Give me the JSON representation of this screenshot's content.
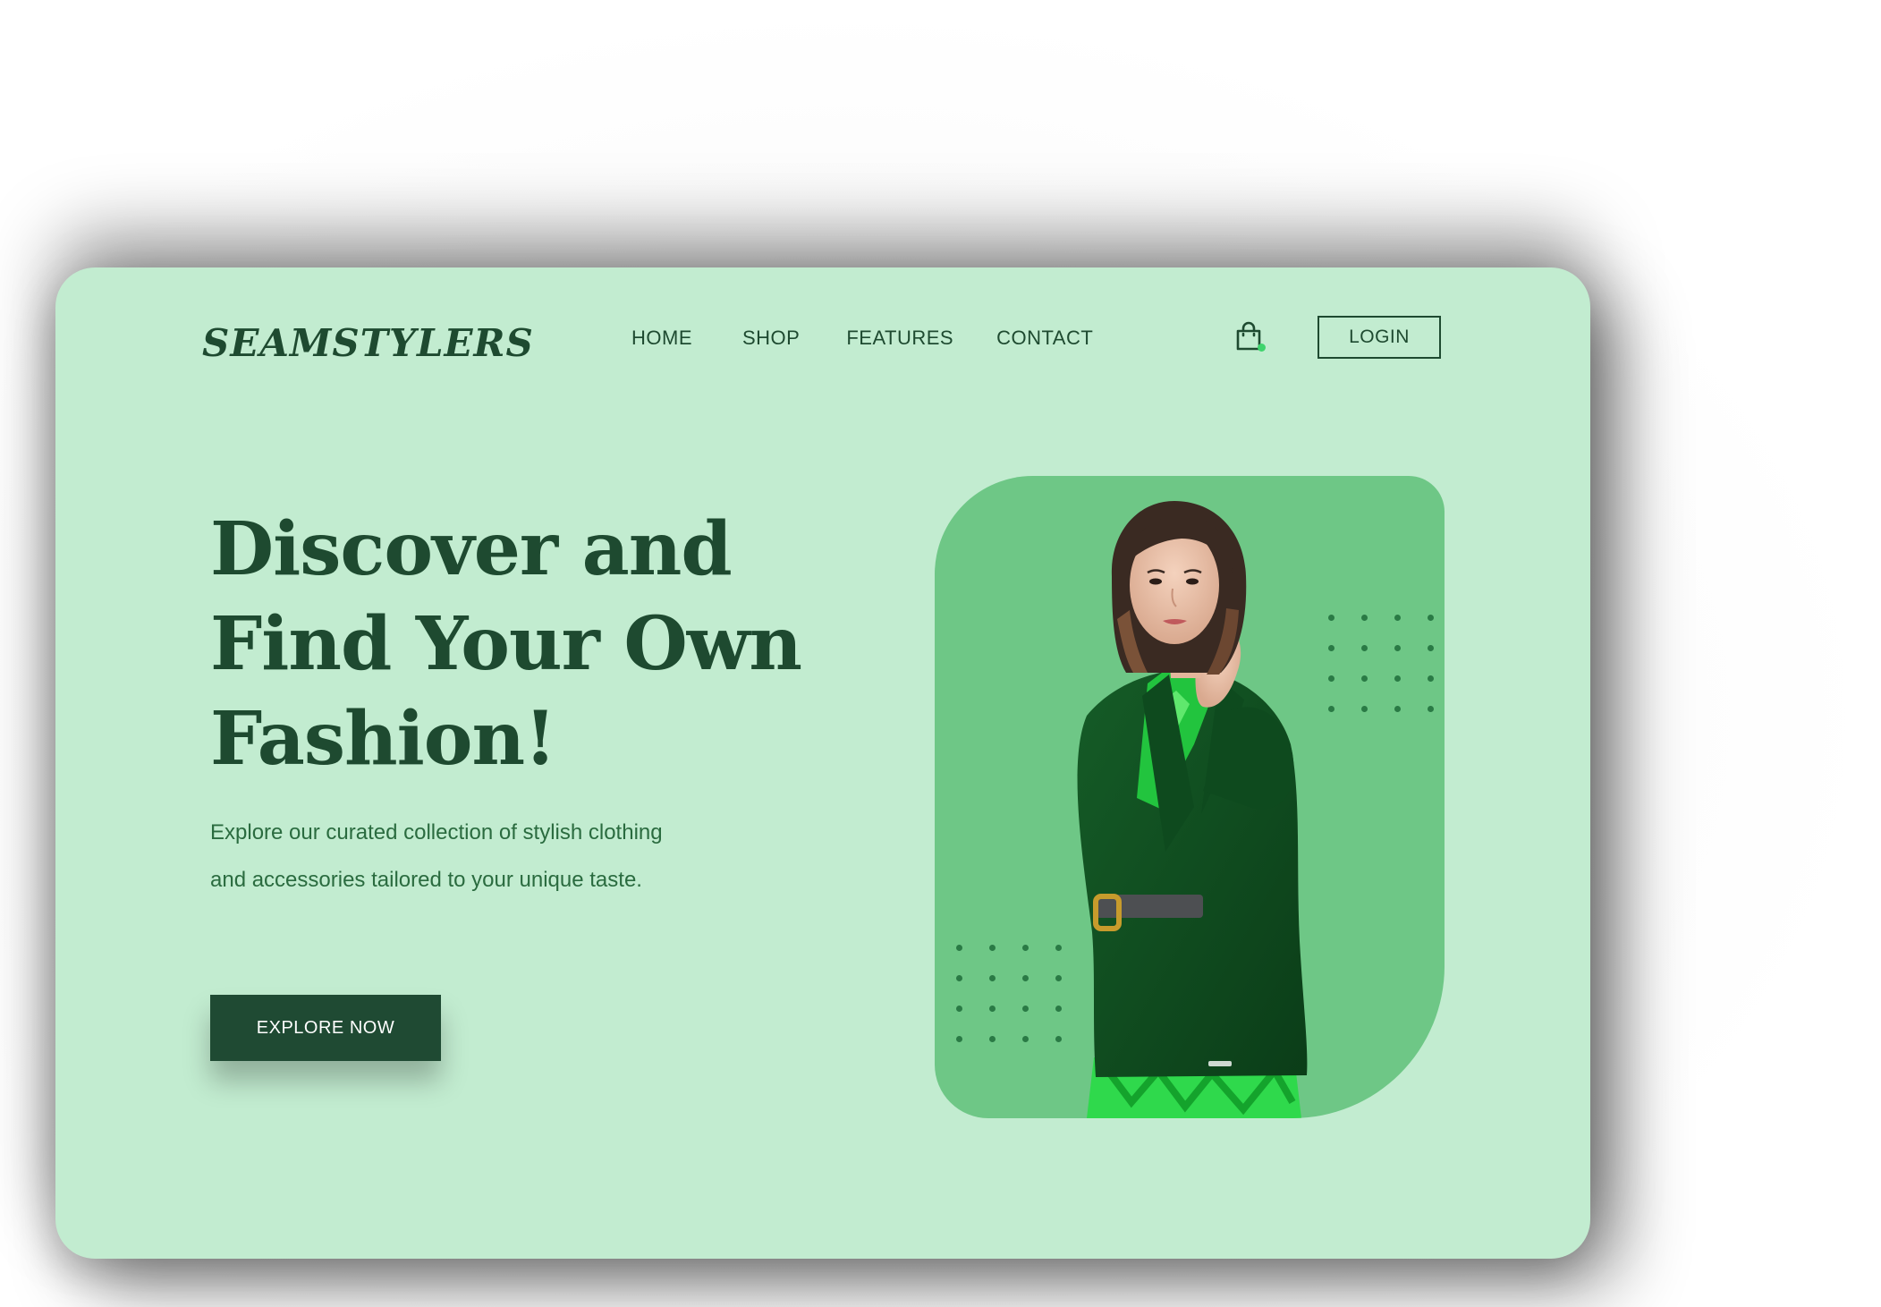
{
  "brand": {
    "logo": "SEAMSTYLERS"
  },
  "nav": {
    "items": [
      {
        "label": "HOME"
      },
      {
        "label": "SHOP"
      },
      {
        "label": "FEATURES"
      },
      {
        "label": "CONTACT"
      }
    ]
  },
  "header": {
    "cart_icon": "shopping-bag-icon",
    "login_label": "LOGIN"
  },
  "hero": {
    "headline_lines": [
      "Discover and",
      "Find Your Own",
      "Fashion!"
    ],
    "description": "Explore our curated collection of stylish clothing and accessories tailored to your unique taste.",
    "cta_label": "EXPLORE NOW"
  },
  "colors": {
    "background": "#c2ecd0",
    "primary": "#1e4a30",
    "accent": "#6ec786",
    "cart_badge": "#3fd46d"
  }
}
